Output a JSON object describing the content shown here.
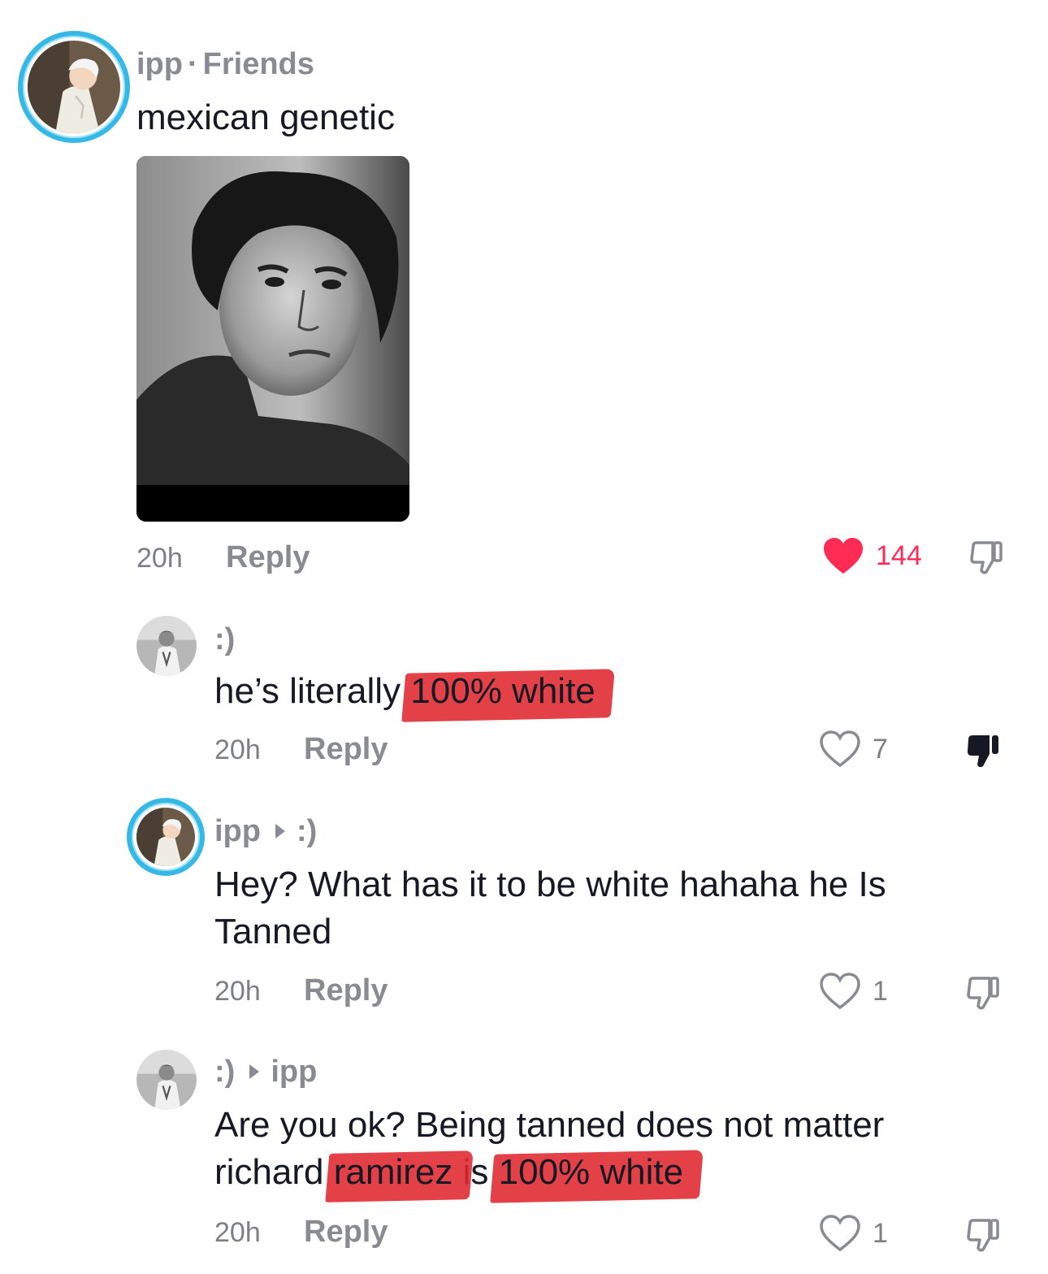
{
  "comments": [
    {
      "author": "ipp",
      "tag": "Friends",
      "text": "mexican genetic",
      "time": "20h",
      "reply_label": "Reply",
      "likes": "144",
      "liked": true
    },
    {
      "author": ":)",
      "text_before": "he’s literally ",
      "text_highlight": "100% white",
      "time": "20h",
      "reply_label": "Reply",
      "likes": "7",
      "disliked": true
    },
    {
      "author": "ipp",
      "reply_to": ":)",
      "text": "Hey? What has it to be white hahaha he Is Tanned",
      "time": "20h",
      "reply_label": "Reply",
      "likes": "1"
    },
    {
      "author": ":)",
      "reply_to": "ipp",
      "text_before": "Are you ok? Being tanned does not matter richard ",
      "text_highlight_1": "ramirez",
      "text_middle": " is ",
      "text_highlight_2": "100% white",
      "time": "20h",
      "reply_label": "Reply",
      "likes": "1"
    }
  ],
  "colors": {
    "like_active": "#fe2c55",
    "avatar_ring": "#35b8e6",
    "highlight_scribble": "#e0262e",
    "muted_text": "#8a8b91"
  },
  "icons": {
    "like": "heart-icon",
    "dislike": "thumbs-down-icon",
    "reply_arrow": "triangle-right-icon"
  }
}
